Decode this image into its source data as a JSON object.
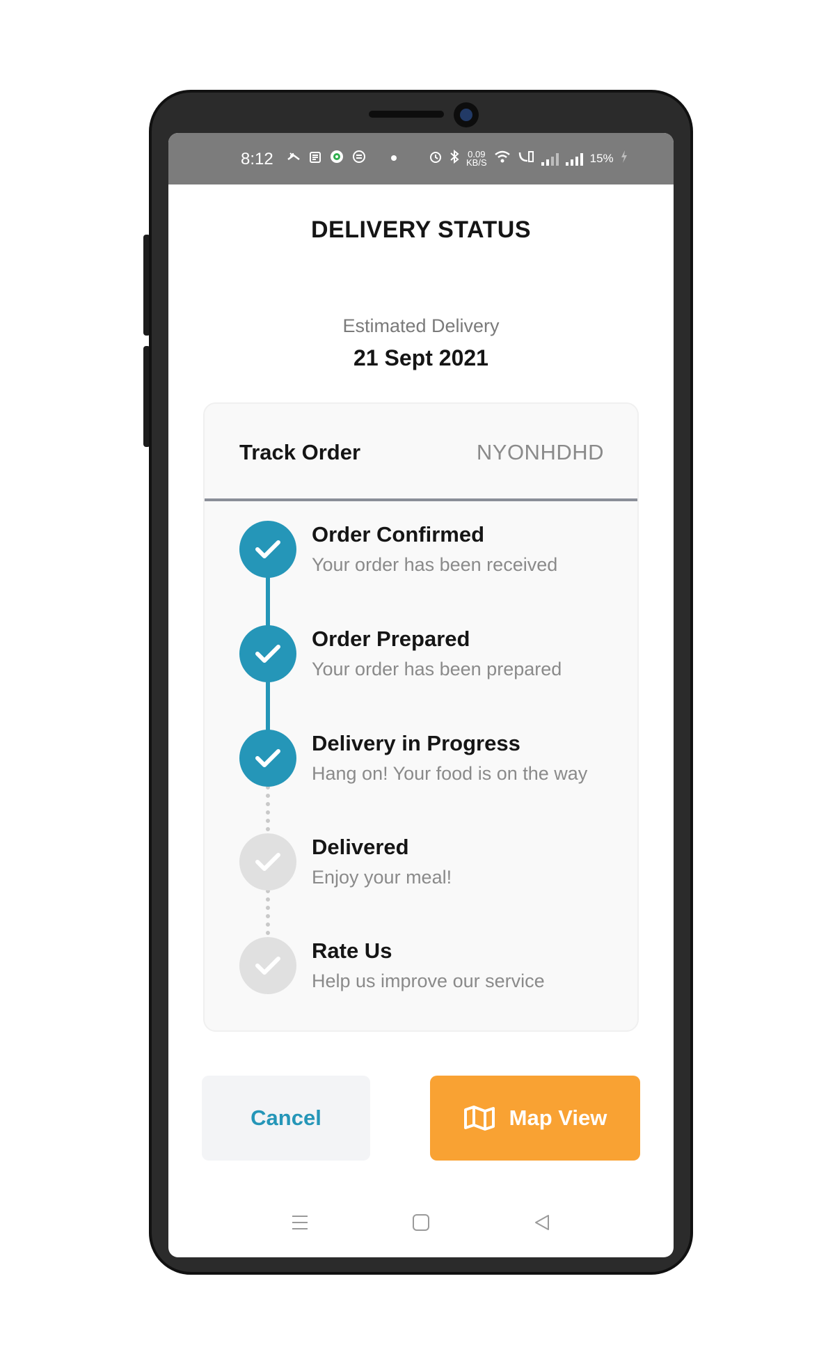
{
  "status_bar": {
    "time": "8:12",
    "speed_value": "0.09",
    "speed_unit": "KB/S",
    "battery": "15%"
  },
  "header": {
    "title": "DELIVERY STATUS"
  },
  "estimate": {
    "label": "Estimated Delivery",
    "date": "21 Sept 2021"
  },
  "tracking": {
    "label": "Track Order",
    "order_id": "NYONHDHD"
  },
  "steps": [
    {
      "title": "Order Confirmed",
      "description": "Your order has been received",
      "done": true
    },
    {
      "title": "Order Prepared",
      "description": "Your order has been prepared",
      "done": true
    },
    {
      "title": "Delivery in Progress",
      "description": "Hang on! Your food is on the way",
      "done": true
    },
    {
      "title": "Delivered",
      "description": "Enjoy your meal!",
      "done": false
    },
    {
      "title": "Rate Us",
      "description": "Help us improve our service",
      "done": false
    }
  ],
  "actions": {
    "cancel_label": "Cancel",
    "map_label": "Map View"
  },
  "colors": {
    "primary": "#2596b8",
    "accent": "#f9a233",
    "pending": "#e0e0e0"
  },
  "icons": {
    "step_icon": "check-icon",
    "map_icon": "map-icon"
  }
}
